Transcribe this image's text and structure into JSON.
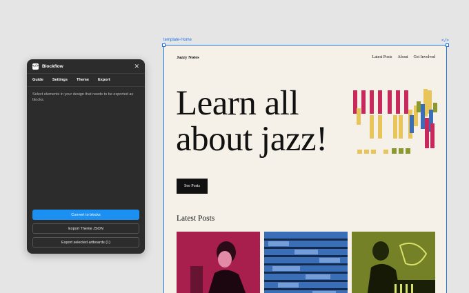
{
  "plugin": {
    "title": "Blockflow",
    "logo_text": "</>",
    "tabs": [
      "Guide",
      "Settings",
      "Theme",
      "Export"
    ],
    "description": "Select elements in your design that needs to be exported as blocks.",
    "buttons": {
      "convert": "Convert to blocks",
      "export_theme": "Export Theme JSON",
      "export_artboards": "Export selected artboards (1)"
    },
    "accent_color": "#1b8ff2",
    "panel_color": "#2c2c2c"
  },
  "canvas": {
    "frame_label": "template-Home",
    "code_icon": "</>",
    "selection_color": "#1a73e8"
  },
  "site": {
    "title": "Jazzy Notes",
    "nav": [
      "Latest Posts",
      "About",
      "Get Involved"
    ],
    "hero": [
      "Learn all",
      "about jazz!"
    ],
    "cta": "See Posts",
    "latest_heading": "Latest Posts",
    "background": "#f5f1e8",
    "art_colors": [
      "#c8295d",
      "#e8c55a",
      "#3a6fb8",
      "#8a9a2e"
    ]
  }
}
